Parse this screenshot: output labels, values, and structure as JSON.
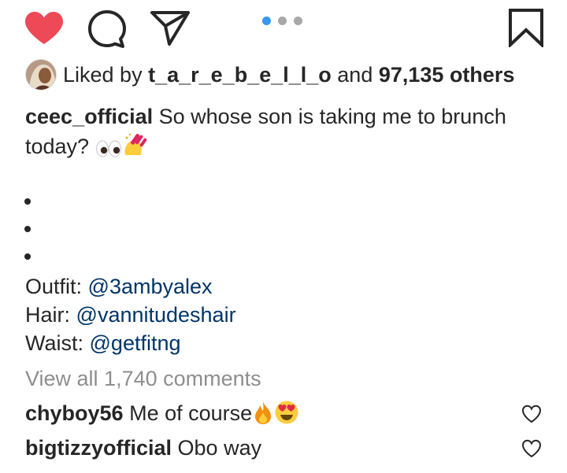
{
  "actions": {
    "like_icon": "heart-filled-icon",
    "comment_icon": "comment-bubble-icon",
    "share_icon": "paper-plane-icon",
    "save_icon": "bookmark-icon",
    "like_color": "#ed4956"
  },
  "carousel": {
    "dot_count": 3,
    "active_index": 0,
    "active_color": "#3897f0",
    "inactive_color": "#a8a8a8"
  },
  "likes": {
    "prefix": "Liked by",
    "user": "t_a_r_e_b_e_l_l_o",
    "connector": "and",
    "count": "97,135 others"
  },
  "caption": {
    "username": "ceec_official",
    "text": "So whose son is taking me to brunch today?",
    "emojis": [
      "eyes",
      "nail-polish"
    ]
  },
  "credits": [
    {
      "label": "Outfit:",
      "mention": "@3ambyalex"
    },
    {
      "label": "Hair:",
      "mention": "@vannitudeshair"
    },
    {
      "label": "Waist:",
      "mention": "@getfitng"
    }
  ],
  "view_comments": "View all 1,740 comments",
  "comments": [
    {
      "username": "chyboy56",
      "text": "Me of course",
      "emojis": [
        "fire",
        "heart-eyes"
      ]
    },
    {
      "username": "bigtizzyofficial",
      "text": "Obo way",
      "emojis": []
    }
  ],
  "colors": {
    "text": "#262626",
    "mention": "#003569",
    "muted": "#8e8e8e"
  }
}
